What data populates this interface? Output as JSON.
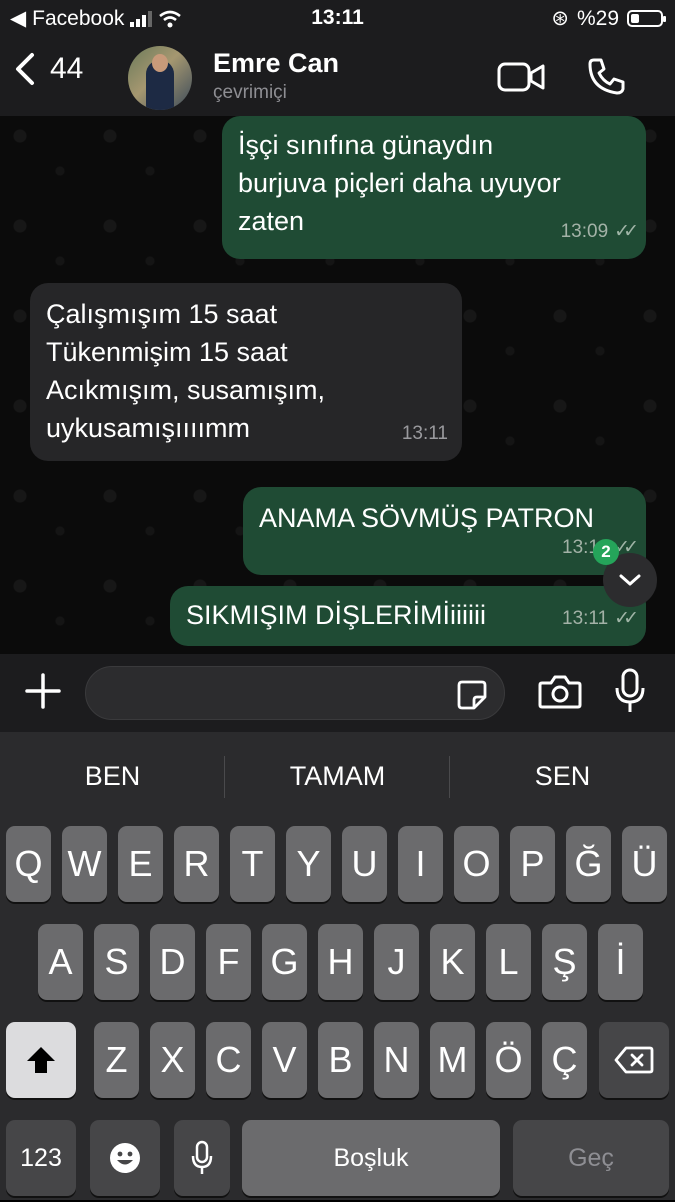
{
  "status": {
    "back_app": "Facebook",
    "time": "13:11",
    "battery": "%29",
    "battery_level": 0.29
  },
  "header": {
    "back_count": "44",
    "name": "Emre Can",
    "presence": "çevrimiçi"
  },
  "messages": [
    {
      "lines": [
        "İşçi sınıfına günaydın",
        "burjuva piçleri daha uyuyor",
        "zaten"
      ],
      "time": "13:09"
    },
    {
      "lines": [
        "Çalışmışım 15 saat",
        "Tükenmişim 15 saat",
        "Acıkmışım, susamışım,",
        "uykusamışıııımm"
      ],
      "time": "13:11"
    },
    {
      "lines": [
        "ANAMA SÖVMÜŞ PATRON"
      ],
      "time": "13:11"
    },
    {
      "lines": [
        "SIKMIŞIM DİŞLERİMİiiiiii"
      ],
      "time": "13:11"
    }
  ],
  "unread_badge": "2",
  "input": {
    "placeholder": ""
  },
  "suggestions": [
    "BEN",
    "TAMAM",
    "SEN"
  ],
  "keys": {
    "row1": [
      "Q",
      "W",
      "E",
      "R",
      "T",
      "Y",
      "U",
      "I",
      "O",
      "P",
      "Ğ",
      "Ü"
    ],
    "row2": [
      "A",
      "S",
      "D",
      "F",
      "G",
      "H",
      "J",
      "K",
      "L",
      "Ş",
      "İ"
    ],
    "row3": [
      "Z",
      "X",
      "C",
      "V",
      "B",
      "N",
      "M",
      "Ö",
      "Ç"
    ],
    "numbers": "123",
    "space": "Boşluk",
    "return": "Geç"
  },
  "icons": [
    "back-chevron-icon",
    "video-call-icon",
    "phone-icon",
    "plus-icon",
    "sticker-icon",
    "camera-icon",
    "microphone-icon",
    "chevron-down-icon",
    "shift-icon",
    "backspace-icon",
    "emoji-icon",
    "dictation-icon"
  ]
}
